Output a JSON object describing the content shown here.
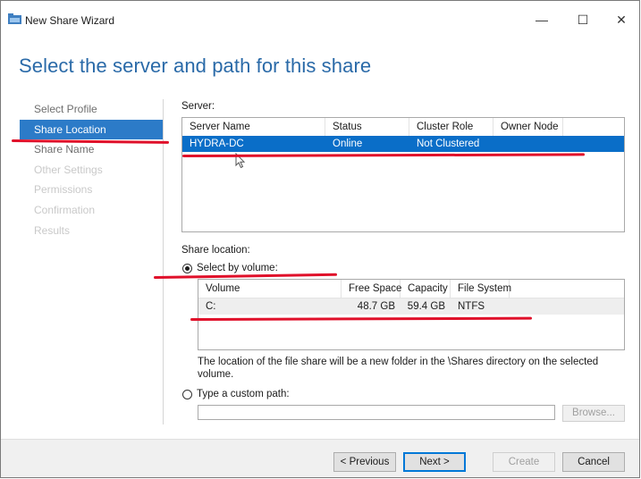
{
  "window": {
    "title": "New Share Wizard",
    "minimize": "—",
    "maximize": "☐",
    "close": "✕"
  },
  "page": {
    "header": "Select the server and path for this share"
  },
  "nav": {
    "items": [
      {
        "label": "Select Profile",
        "state": "normal"
      },
      {
        "label": "Share Location",
        "state": "active"
      },
      {
        "label": "Share Name",
        "state": "normal"
      },
      {
        "label": "Other Settings",
        "state": "disabled"
      },
      {
        "label": "Permissions",
        "state": "disabled"
      },
      {
        "label": "Confirmation",
        "state": "disabled"
      },
      {
        "label": "Results",
        "state": "disabled"
      }
    ]
  },
  "server": {
    "label": "Server:",
    "columns": [
      "Server Name",
      "Status",
      "Cluster Role",
      "Owner Node"
    ],
    "rows": [
      {
        "name": "HYDRA-DC",
        "status": "Online",
        "cluster_role": "Not Clustered",
        "owner_node": ""
      }
    ]
  },
  "share_location": {
    "label": "Share location:",
    "by_volume_label": "Select by volume:",
    "volume_columns": [
      "Volume",
      "Free Space",
      "Capacity",
      "File System"
    ],
    "volume_rows": [
      {
        "volume": "C:",
        "free_space": "48.7 GB",
        "capacity": "59.4 GB",
        "file_system": "NTFS"
      }
    ],
    "info_text": "The location of the file share will be a new folder in the \\Shares directory on the selected volume.",
    "custom_path_label": "Type a custom path:",
    "custom_path_value": "",
    "browse_label": "Browse..."
  },
  "buttons": {
    "previous": "< Previous",
    "next": "Next >",
    "create": "Create",
    "cancel": "Cancel"
  },
  "colors": {
    "header_blue": "#2a6aa8",
    "nav_active": "#2c7bc8",
    "row_selected": "#0a6ec8",
    "annotation_red": "#e0102a"
  }
}
